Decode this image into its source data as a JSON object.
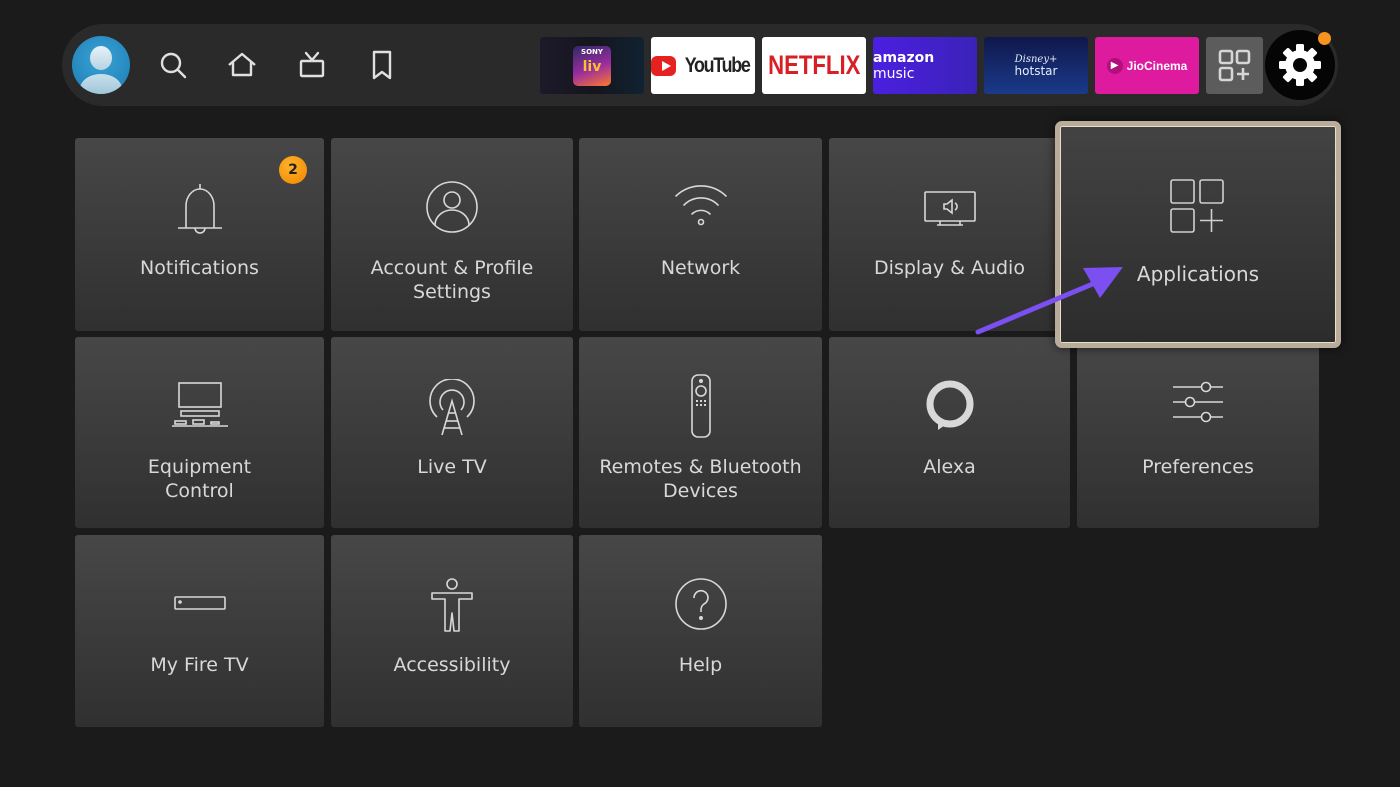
{
  "navbar": {
    "icons": [
      "profile-avatar",
      "search-icon",
      "home-icon",
      "live-tv-icon",
      "bookmark-icon"
    ],
    "apps": [
      {
        "name": "sonyliv",
        "top": "SONY",
        "bottom": "liv"
      },
      {
        "name": "youtube",
        "label": "YouTube"
      },
      {
        "name": "netflix",
        "label": "NETFLIX"
      },
      {
        "name": "amazon-music",
        "label_bold": "amazon",
        "label": "music"
      },
      {
        "name": "hotstar",
        "top": "Disney+",
        "bottom": "hotstar"
      },
      {
        "name": "jiocinema",
        "label": "JioCinema"
      }
    ],
    "all_apps_icon": "apps-grid-icon",
    "settings_icon": "gear-icon",
    "settings_indicator_color": "#f7941d"
  },
  "settings": {
    "tiles": [
      {
        "label": "Notifications",
        "icon": "bell-icon",
        "badge": "2"
      },
      {
        "label": "Account & Profile Settings",
        "icon": "account-icon"
      },
      {
        "label": "Network",
        "icon": "wifi-icon"
      },
      {
        "label": "Display & Audio",
        "icon": "display-audio-icon"
      },
      {
        "label": "Applications",
        "icon": "apps-icon",
        "focused": true
      },
      {
        "label": "Equipment Control",
        "icon": "equipment-icon"
      },
      {
        "label": "Live TV",
        "icon": "antenna-icon"
      },
      {
        "label": "Remotes & Bluetooth Devices",
        "icon": "remote-icon"
      },
      {
        "label": "Alexa",
        "icon": "alexa-icon"
      },
      {
        "label": "Preferences",
        "icon": "sliders-icon"
      },
      {
        "label": "My Fire TV",
        "icon": "fire-tv-device-icon"
      },
      {
        "label": "Accessibility",
        "icon": "accessibility-icon"
      },
      {
        "label": "Help",
        "icon": "help-icon"
      }
    ]
  },
  "annotation": {
    "type": "arrow",
    "color": "#7b4ff0",
    "points_to": "Applications"
  }
}
